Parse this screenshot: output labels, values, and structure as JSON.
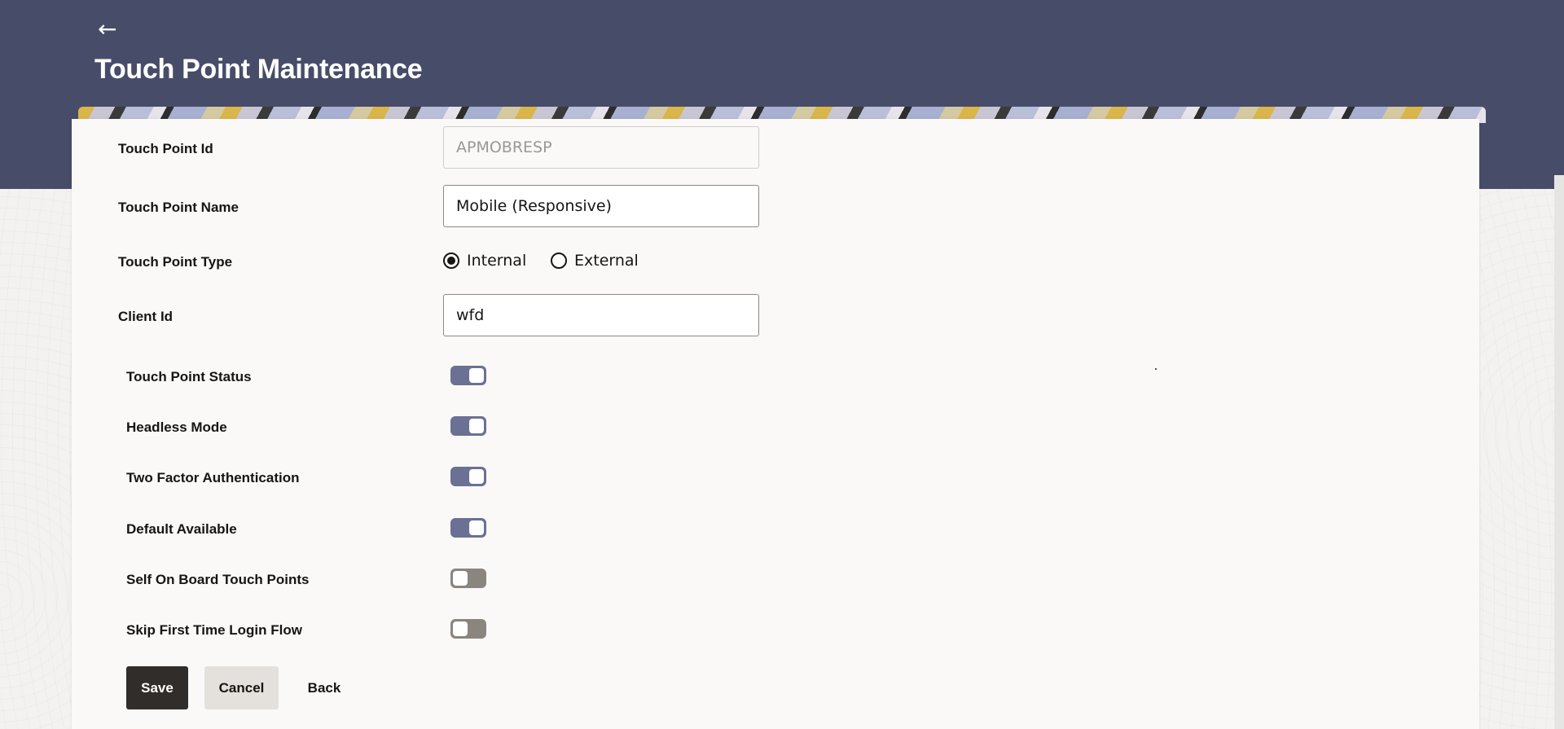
{
  "header": {
    "title": "Touch Point Maintenance",
    "back_icon": "arrow-left-icon"
  },
  "form": {
    "touch_point_id": {
      "label": "Touch Point Id",
      "value": "APMOBRESP"
    },
    "touch_point_name": {
      "label": "Touch Point Name",
      "value": "Mobile (Responsive)"
    },
    "touch_point_type": {
      "label": "Touch Point Type",
      "options": [
        {
          "label": "Internal",
          "selected": true
        },
        {
          "label": "External",
          "selected": false
        }
      ]
    },
    "client_id": {
      "label": "Client Id",
      "value": "wfd"
    },
    "toggles": [
      {
        "label": "Touch Point Status",
        "on": true
      },
      {
        "label": "Headless Mode",
        "on": true
      },
      {
        "label": "Two Factor Authentication",
        "on": true
      },
      {
        "label": "Default Available",
        "on": true
      },
      {
        "label": "Self On Board Touch Points",
        "on": false
      },
      {
        "label": "Skip First Time Login Flow",
        "on": false
      }
    ]
  },
  "actions": {
    "save_label": "Save",
    "cancel_label": "Cancel",
    "back_label": "Back"
  },
  "colors": {
    "header_bg": "#474c69",
    "toggle_on": "#6b7194",
    "toggle_off": "#8b857f",
    "primary_button": "#312d2a"
  }
}
